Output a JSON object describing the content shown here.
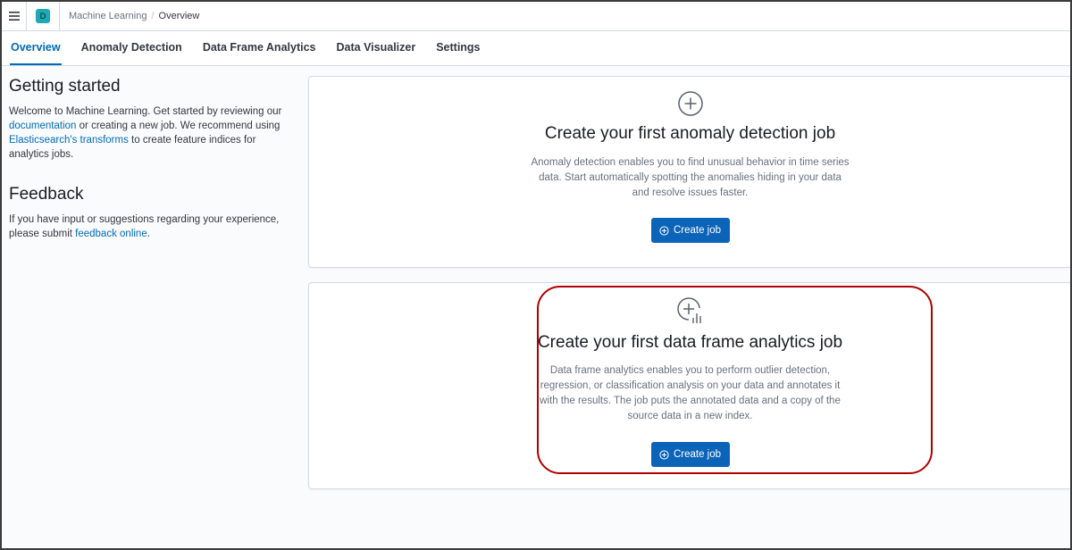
{
  "header": {
    "space_initial": "D",
    "breadcrumbs": [
      "Machine Learning",
      "Overview"
    ]
  },
  "tabs": [
    {
      "label": "Overview",
      "active": true
    },
    {
      "label": "Anomaly Detection",
      "active": false
    },
    {
      "label": "Data Frame Analytics",
      "active": false
    },
    {
      "label": "Data Visualizer",
      "active": false
    },
    {
      "label": "Settings",
      "active": false
    }
  ],
  "getting_started": {
    "title": "Getting started",
    "text_1": "Welcome to Machine Learning. Get started by reviewing our",
    "link_docs": "documentation",
    "text_2": " or creating a new job. We recommend using",
    "link_transforms": "Elasticsearch's transforms",
    "text_3": " to create feature indices for analytics jobs."
  },
  "feedback": {
    "title": "Feedback",
    "text_1": "If you have input or suggestions regarding your experience, please submit ",
    "link": "feedback online",
    "text_2": "."
  },
  "anomaly_card": {
    "icon": "plus-circle-icon",
    "title": "Create your first anomaly detection job",
    "description": "Anomaly detection enables you to find unusual behavior in time series data. Start automatically spotting the anomalies hiding in your data and resolve issues faster.",
    "button": "Create job"
  },
  "dfa_card": {
    "icon": "plus-circle-chart-icon",
    "title": "Create your first data frame analytics job",
    "description": "Data frame analytics enables you to perform outlier detection, regression, or classification analysis on your data and annotates it with the results. The job puts the annotated data and a copy of the source data in a new index.",
    "button": "Create job"
  },
  "colors": {
    "accent": "#006bb8",
    "button": "#0b64b8",
    "highlight": "#b00000"
  }
}
